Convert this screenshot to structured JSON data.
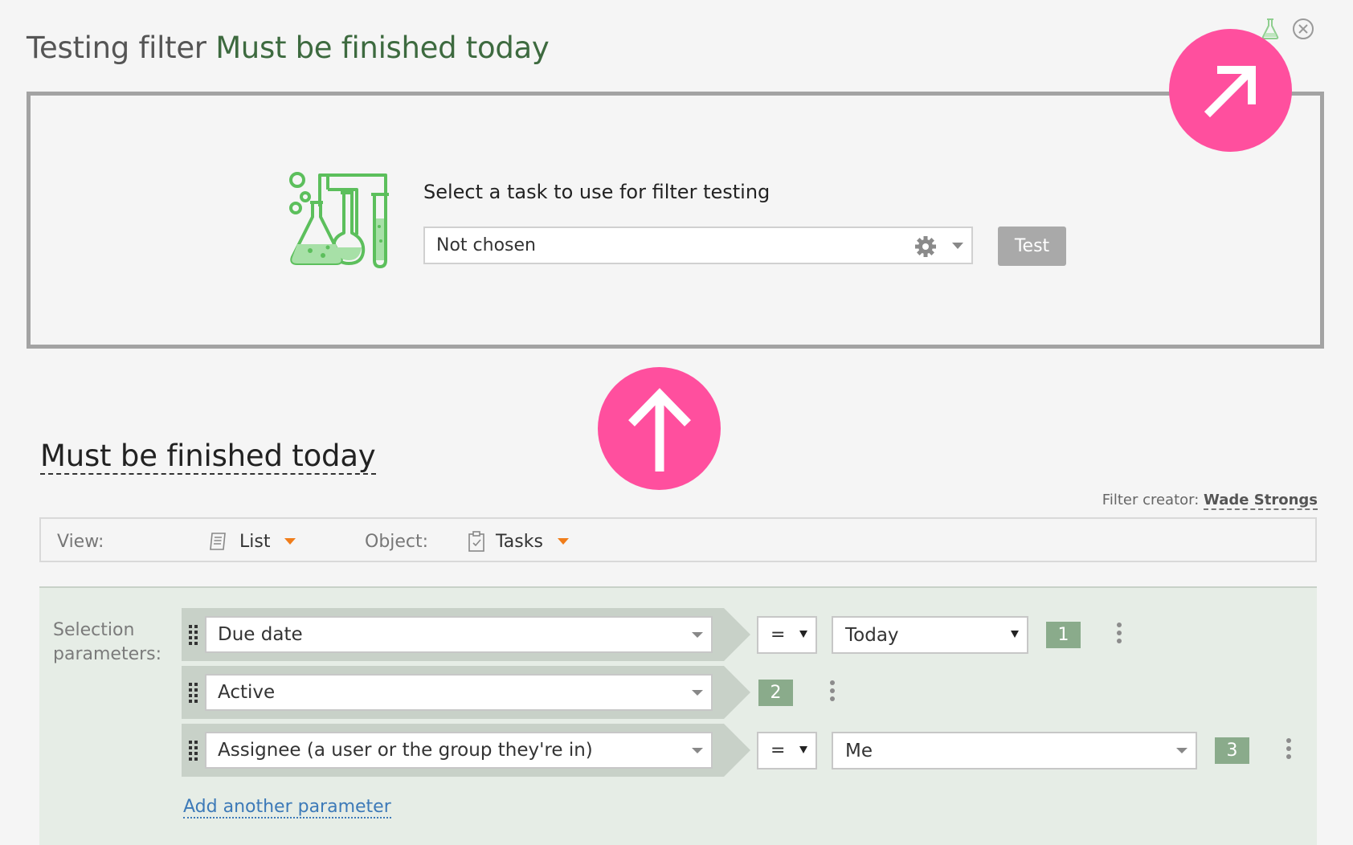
{
  "header": {
    "title_prefix": "Testing filter",
    "title_filter": "Must be finished today"
  },
  "top_icons": [
    "flask-icon",
    "close-icon"
  ],
  "test_panel": {
    "illustration": "lab-equipment-illustration",
    "select_label": "Select a task to use for filter testing",
    "select_value": "Not chosen",
    "test_button": "Test"
  },
  "filter": {
    "name": "Must be finished today",
    "creator_label": "Filter creator:",
    "creator_name": "Wade Strongs"
  },
  "view_bar": {
    "view_label": "View:",
    "view_value": "List",
    "object_label": "Object:",
    "object_value": "Tasks"
  },
  "params": {
    "label_line1": "Selection",
    "label_line2": "parameters:",
    "rows": [
      {
        "field": "Due date",
        "operator": "=",
        "value": "Today",
        "number": "1"
      },
      {
        "field": "Active",
        "number": "2"
      },
      {
        "field": "Assignee (a user or the group they're in)",
        "operator": "=",
        "value": "Me",
        "number": "3"
      }
    ],
    "add_link": "Add another parameter"
  },
  "colors": {
    "accent_green": "#3d6a3f",
    "pink_marker": "#ff4f9e",
    "badge_green": "#8aab8b",
    "link_blue": "#3d7ab8",
    "orange_caret": "#f07d1a"
  }
}
